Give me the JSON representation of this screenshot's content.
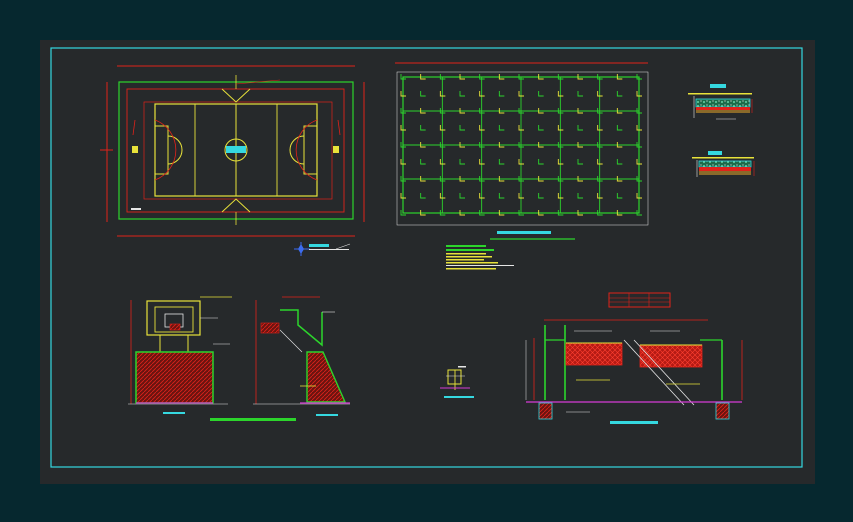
{
  "drawing": {
    "background": "#06282f",
    "sheet_fill": "#26292b",
    "frame_color": "#35d8e0"
  },
  "colors": {
    "red": "#e0221a",
    "yellow": "#e8e23a",
    "green": "#2cd52c",
    "cyan": "#35d8e0",
    "magenta": "#d53bd5",
    "white": "#e6e6e6",
    "blue": "#3c6cf0"
  },
  "views": [
    {
      "name": "court-plan",
      "icon": "basketball-court-plan-icon"
    },
    {
      "name": "lighting-grid-plan",
      "icon": "grid-plan-icon"
    },
    {
      "name": "pavement-section-top",
      "icon": "section-detail-icon"
    },
    {
      "name": "pavement-section-bottom",
      "icon": "section-detail-icon"
    },
    {
      "name": "hoop-front-elevation",
      "icon": "backboard-elevation-icon"
    },
    {
      "name": "hoop-side-elevation",
      "icon": "backboard-side-icon"
    },
    {
      "name": "anchor-detail",
      "icon": "anchor-detail-icon"
    },
    {
      "name": "net-post-elevation",
      "icon": "net-elevation-icon"
    },
    {
      "name": "general-notes",
      "icon": "notes-block-icon"
    },
    {
      "name": "north-arrow",
      "icon": "north-arrow-icon"
    }
  ]
}
